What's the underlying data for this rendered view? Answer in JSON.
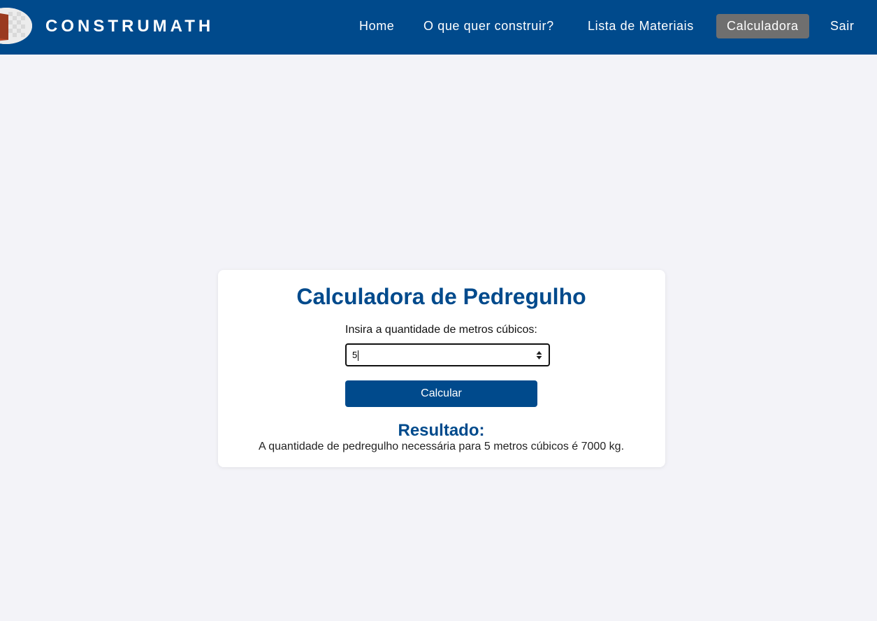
{
  "header": {
    "brand": "CONSTRUMATH",
    "logo_icon": "brick-icon",
    "nav": [
      {
        "label": "Home",
        "active": false
      },
      {
        "label": "O que quer construir?",
        "active": false
      },
      {
        "label": "Lista de Materiais",
        "active": false
      },
      {
        "label": "Calculadora",
        "active": true
      },
      {
        "label": "Sair",
        "active": false
      }
    ]
  },
  "calculator": {
    "title": "Calculadora de Pedregulho",
    "input_label": "Insira a quantidade de metros cúbicos:",
    "input_value": "5",
    "button_label": "Calcular",
    "result_title": "Resultado:",
    "result_text": "A quantidade de pedregulho necessária para 5 metros cúbicos é 7000 kg."
  },
  "colors": {
    "primary": "#004a8c",
    "background": "#f3f3f8",
    "active_nav": "#6f6f6f",
    "card": "#ffffff"
  }
}
